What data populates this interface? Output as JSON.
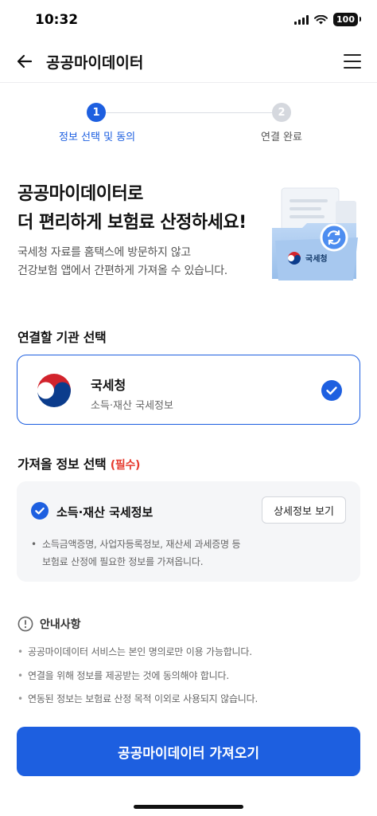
{
  "status_bar": {
    "time": "10:32",
    "battery": "100"
  },
  "header": {
    "title": "공공마이데이터"
  },
  "stepper": {
    "steps": [
      {
        "number": "1",
        "label": "정보 선택 및 동의"
      },
      {
        "number": "2",
        "label": "연결 완료"
      }
    ]
  },
  "hero": {
    "title_line1": "공공마이데이터로",
    "title_line2": "더 편리하게 보험료 산정하세요!",
    "desc_line1": "국세청 자료를 홈택스에 방문하지 않고",
    "desc_line2": "건강보험 앱에서 간편하게 가져올 수 있습니다.",
    "illust_label": "국세청"
  },
  "agency_section": {
    "title": "연결할 기관 선택",
    "agency": {
      "name": "국세청",
      "sub": "소득·재산 국세정보"
    }
  },
  "info_section": {
    "title": "가져올 정보 선택",
    "required": "(필수)",
    "item_title": "소득·재산 국세정보",
    "detail_button": "상세정보 보기",
    "desc_line1": "소득금액증명, 사업자등록정보, 재산세 과세증명 등",
    "desc_line2": "보험료 산정에 필요한 정보를 가져옵니다."
  },
  "notice": {
    "title": "안내사항",
    "items": [
      "공공마이데이터 서비스는 본인 명의로만 이용 가능합니다.",
      "연결을 위해 정보를 제공받는 것에 동의해야 합니다.",
      "연동된 정보는 보험료 산정 목적 이외로 사용되지 않습니다."
    ]
  },
  "cta": {
    "label": "공공마이데이터 가져오기"
  },
  "colors": {
    "primary": "#1d5fe0",
    "required": "#e63a2e",
    "background_box": "#f5f6f8"
  },
  "icons": [
    "back-arrow-icon",
    "menu-icon",
    "signal-icon",
    "wifi-icon",
    "battery-icon",
    "check-circle-icon",
    "info-circle-icon",
    "refresh-icon",
    "taegeuk-logo"
  ]
}
